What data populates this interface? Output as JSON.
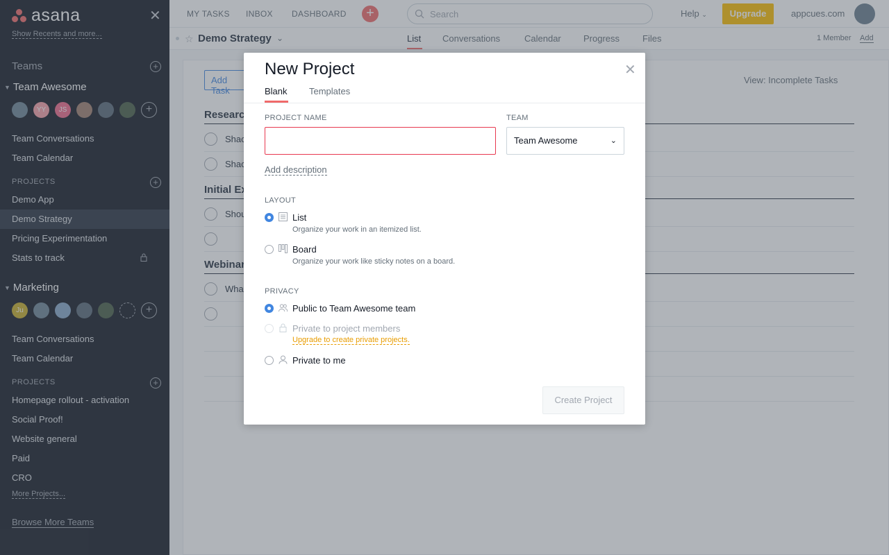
{
  "sidebar": {
    "logo": "asana",
    "show_recents": "Show Recents and more...",
    "teams_label": "Teams",
    "team1": {
      "name": "Team Awesome",
      "avatars": [
        "",
        "YY",
        "JS",
        "",
        "",
        ""
      ],
      "conversations": "Team Conversations",
      "calendar": "Team Calendar",
      "projects_label": "PROJECTS",
      "projects": [
        "Demo App",
        "Demo Strategy",
        "Pricing Experimentation",
        "Stats to track"
      ]
    },
    "team2": {
      "name": "Marketing",
      "avatars": [
        "Ju",
        "",
        "",
        "",
        "",
        ""
      ],
      "conversations": "Team Conversations",
      "calendar": "Team Calendar",
      "projects_label": "PROJECTS",
      "projects": [
        "Homepage rollout - activation",
        "Social Proof!",
        "Website general",
        "Paid",
        "CRO"
      ],
      "more_projects": "More Projects..."
    },
    "browse": "Browse More Teams"
  },
  "topbar": {
    "my_tasks": "MY TASKS",
    "inbox": "INBOX",
    "dashboard": "DASHBOARD",
    "search_placeholder": "Search",
    "help": "Help",
    "upgrade": "Upgrade",
    "org": "appcues.com"
  },
  "project": {
    "title": "Demo Strategy",
    "tabs": [
      "List",
      "Conversations",
      "Calendar",
      "Progress",
      "Files"
    ],
    "members": "1 Member",
    "add": "Add",
    "add_task": "Add Task",
    "view": "View: Incomplete Tasks",
    "sections": [
      "Research",
      "Initial Ex",
      "Webinar"
    ],
    "tasks": [
      "Shac",
      "Shac",
      "Shou",
      "",
      "What",
      ""
    ]
  },
  "modal": {
    "title": "New Project",
    "tabs": [
      "Blank",
      "Templates"
    ],
    "project_name_label": "PROJECT NAME",
    "project_name_value": "",
    "team_label": "TEAM",
    "team_value": "Team Awesome",
    "add_description": "Add description",
    "layout_label": "LAYOUT",
    "layout_options": [
      {
        "label": "List",
        "desc": "Organize your work in an itemized list."
      },
      {
        "label": "Board",
        "desc": "Organize your work like sticky notes on a board."
      }
    ],
    "privacy_label": "PRIVACY",
    "privacy_options": [
      {
        "label": "Public to Team Awesome team"
      },
      {
        "label": "Private to project members"
      },
      {
        "label": "Private to me"
      }
    ],
    "upgrade_link": "Upgrade to create private projects.",
    "create_button": "Create Project"
  },
  "colors": {
    "accent": "#f06a6a",
    "primary_blue": "#4186e0",
    "upgrade_yellow": "#fcbd01",
    "sidebar_bg": "#151b26"
  }
}
